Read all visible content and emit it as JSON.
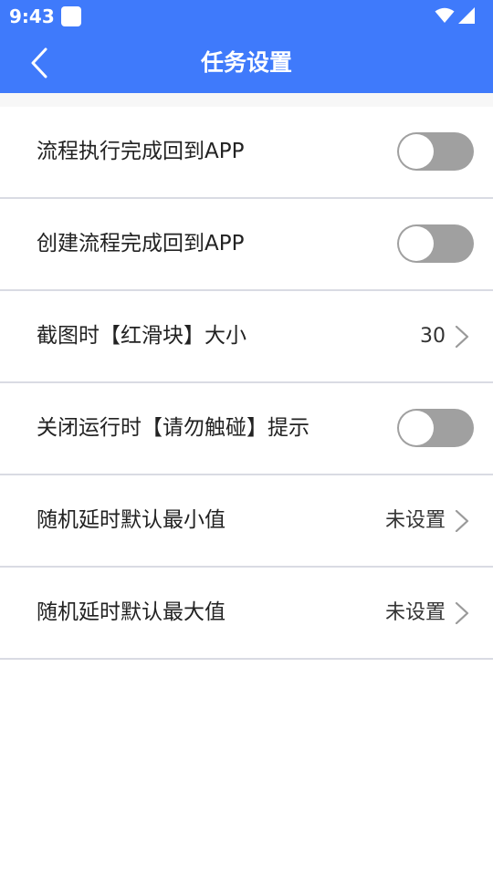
{
  "status_bar": {
    "time": "9:43",
    "icons": [
      "notification-icon",
      "wifi-icon",
      "signal-icon"
    ]
  },
  "header": {
    "title": "任务设置",
    "back_icon": "chevron-left-icon",
    "background_color": "#3f7afb"
  },
  "settings": [
    {
      "label": "流程执行完成回到APP",
      "type": "toggle",
      "enabled": false
    },
    {
      "label": "创建流程完成回到APP",
      "type": "toggle",
      "enabled": false
    },
    {
      "label": "截图时【红滑块】大小",
      "type": "nav",
      "value": "30"
    },
    {
      "label": "关闭运行时【请勿触碰】提示",
      "type": "toggle",
      "enabled": false
    },
    {
      "label": "随机延时默认最小值",
      "type": "nav",
      "value": "未设置"
    },
    {
      "label": "随机延时默认最大值",
      "type": "nav",
      "value": "未设置"
    }
  ],
  "colors": {
    "toggle_off": "#a0a0a0",
    "divider": "#d9dbe3"
  }
}
